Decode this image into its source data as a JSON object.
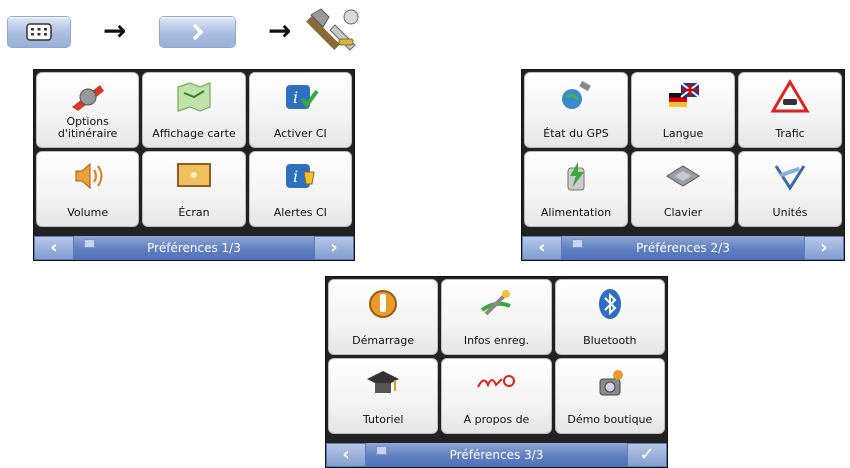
{
  "sequence": {
    "arrow1": "→",
    "arrow2": "→"
  },
  "panels": [
    {
      "title": "Préférences 1/3",
      "footer_right": "›",
      "tiles": [
        {
          "label": "Options\nd'itinéraire",
          "icon": "route-options-icon"
        },
        {
          "label": "Affichage carte",
          "icon": "map-display-icon"
        },
        {
          "label": "Activer CI",
          "icon": "activate-poi-icon"
        },
        {
          "label": "Volume",
          "icon": "volume-icon"
        },
        {
          "label": "Écran",
          "icon": "screen-icon"
        },
        {
          "label": "Alertes CI",
          "icon": "poi-alerts-icon"
        }
      ]
    },
    {
      "title": "Préférences 2/3",
      "footer_right": "›",
      "tiles": [
        {
          "label": "État du GPS",
          "icon": "gps-status-icon"
        },
        {
          "label": "Langue",
          "icon": "language-icon"
        },
        {
          "label": "Trafic",
          "icon": "traffic-icon"
        },
        {
          "label": "Alimentation",
          "icon": "power-icon"
        },
        {
          "label": "Clavier",
          "icon": "keyboard-icon"
        },
        {
          "label": "Unités",
          "icon": "units-icon"
        }
      ]
    },
    {
      "title": "Préférences 3/3",
      "footer_right": "✓",
      "tiles": [
        {
          "label": "Démarrage",
          "icon": "startup-icon"
        },
        {
          "label": "Infos enreg.",
          "icon": "saved-info-icon"
        },
        {
          "label": "Bluetooth",
          "icon": "bluetooth-icon"
        },
        {
          "label": "Tutoriel",
          "icon": "tutorial-icon"
        },
        {
          "label": "A propos de",
          "icon": "mio-logo-icon"
        },
        {
          "label": "Démo boutique",
          "icon": "store-demo-icon"
        }
      ]
    }
  ],
  "footer_left": "‹"
}
